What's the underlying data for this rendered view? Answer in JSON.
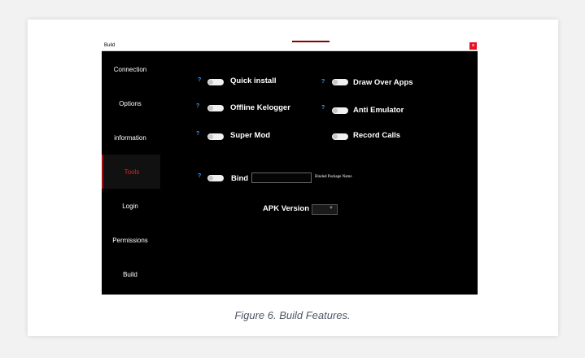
{
  "window": {
    "title": "Build",
    "close_symbol": "×"
  },
  "sidebar": {
    "items": [
      {
        "label": "Connection",
        "active": false
      },
      {
        "label": "Options",
        "active": false
      },
      {
        "label": "information",
        "active": false
      },
      {
        "label": "Tools",
        "active": true
      },
      {
        "label": "Login",
        "active": false
      },
      {
        "label": "Permissions",
        "active": false
      },
      {
        "label": "Build",
        "active": false
      }
    ]
  },
  "options": {
    "help_symbol": "?",
    "quick_install": "Quick install",
    "offline_keylogger": "Offline Kelogger",
    "super_mod": "Super Mod",
    "draw_over_apps": "Draw Over Apps",
    "anti_emulator": "Anti Emulator",
    "record_calls": "Record Calls",
    "bind": "Bind",
    "binded_package_name": "Binded Package Name"
  },
  "apk": {
    "label": "APK Version",
    "arrow_symbol": "▼"
  },
  "caption": "Figure 6. Build Features.",
  "colors": {
    "active_tab": "#e0202a",
    "help": "#3aa0ff",
    "close": "#e81123"
  }
}
